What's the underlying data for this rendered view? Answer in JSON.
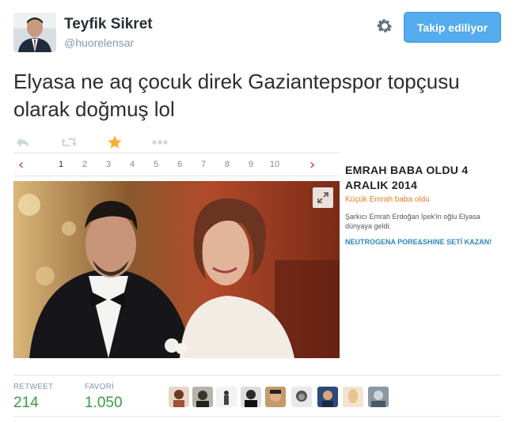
{
  "user": {
    "name": "Teyfik Sikret",
    "handle": "@huorelensar"
  },
  "follow_button": {
    "label": "Takip ediliyor"
  },
  "tweet": {
    "text": "Elyasa ne aq çocuk direk Gaziantepspor topçusu olarak doğmuş lol"
  },
  "actions": {
    "icons": [
      "reply-icon",
      "retweet-icon",
      "favorite-star-icon",
      "more-icon"
    ],
    "accent": "#ffac33"
  },
  "embed": {
    "pager": [
      "1",
      "2",
      "3",
      "4",
      "5",
      "6",
      "7",
      "8",
      "9",
      "10"
    ],
    "pager_active": "1",
    "prev_arrow": "‹",
    "next_arrow": "›",
    "headline": "EMRAH BABA OLDU 4 ARALIK 2014",
    "subtitle": "Küçük Emrah baba oldu",
    "description": "Şarkıcı Emrah Erdoğan İpek'in oğlu Elyasa dünyaya geldi.",
    "promo": "NEUTROGENA PORE&SHINE SETİ KAZAN!"
  },
  "stats": {
    "retweet_label": "RETWEET",
    "retweet_value": "214",
    "favorite_label": "FAVORİ",
    "favorite_value": "1.050",
    "value_color": "#3a9b45"
  },
  "colors": {
    "follow_bg": "#55acee",
    "text": "#292f33",
    "muted": "#8899a6"
  }
}
